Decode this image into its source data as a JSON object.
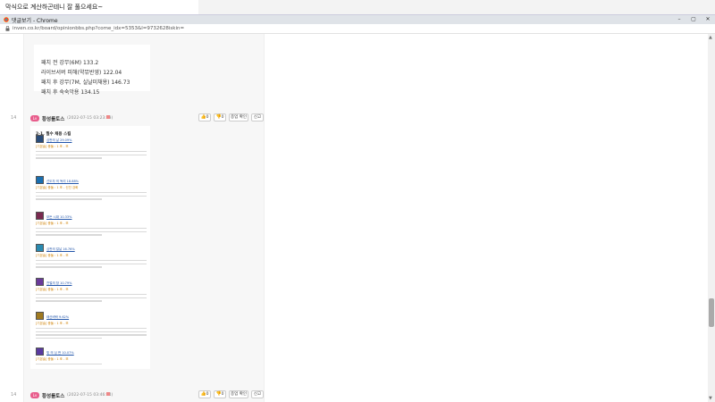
{
  "background_window": {
    "text": "막식으로 계산하곤테니 잘 풀으세요~"
  },
  "window": {
    "title": "댓글보기 - Chrome",
    "controls": {
      "minimize": "–",
      "maximize": "▢",
      "close": "✕"
    }
  },
  "address": {
    "url": "inven.co.kr/board/opinionbbs.php?come_idx=5353&l=9732628iskin="
  },
  "stats": {
    "lines": [
      "패치 전 강무(6M) 133.2",
      "라이브서버 피해(약뮤반영) 122.04",
      "패치 후 강무(7M, 실날미채용) 146.73",
      "패치 후 숙숙악용 134.15"
    ]
  },
  "comments": [
    {
      "num": "14",
      "badge": "Lv",
      "author": "황성롤토스",
      "date": "(2022-07-15 03:23:23)",
      "like_count": "0",
      "dislike_count": "0",
      "quote_label": "종업 확인",
      "report_label": "신고"
    },
    {
      "num": "14",
      "badge": "Lv",
      "author": "황성롤토스",
      "date": "(2022-07-15 03:46:04)",
      "like_count": "0",
      "dislike_count": "0",
      "quote_label": "종업 확인",
      "report_label": "신고"
    }
  ],
  "image_post": {
    "heading": "2-1. 필수 채용 스킬",
    "skills": [
      {
        "name": "심판의 날",
        "pct": "29.09%",
        "rate": "[기본술] 충돌 : 1 조 - 보",
        "icon_color": "#2a4d7a"
      },
      {
        "name": "선도자 의 독리",
        "pct": "18.88%",
        "rate": "[기본술] 충돌 : 1 조 - 신진 강화",
        "icon_color": "#1a6fb0"
      },
      {
        "name": "모든 시대",
        "pct": "10.33%",
        "rate": "[기본술] 충돌 : 1 조 - 보",
        "icon_color": "#7a2a50"
      },
      {
        "name": "심판의 칼날",
        "pct": "16.76%",
        "rate": "[기본술] 충돌 : 1 조 - 보",
        "icon_color": "#2a8ab0"
      },
      {
        "name": "천벌의 창",
        "pct": "10.79%",
        "rate": "[기본술] 충돌 : 1 조 - 보",
        "icon_color": "#6a3a9a"
      },
      {
        "name": "태산벼락",
        "pct": "9.62%",
        "rate": "[기본술] 충돌 : 1 조 - 보",
        "icon_color": "#a07a20"
      },
      {
        "name": "빛 의 심 판",
        "pct": "10.07%",
        "rate": "[기본술] 충돌 : 1 조 - 보",
        "icon_color": "#5a3aa0"
      }
    ]
  }
}
